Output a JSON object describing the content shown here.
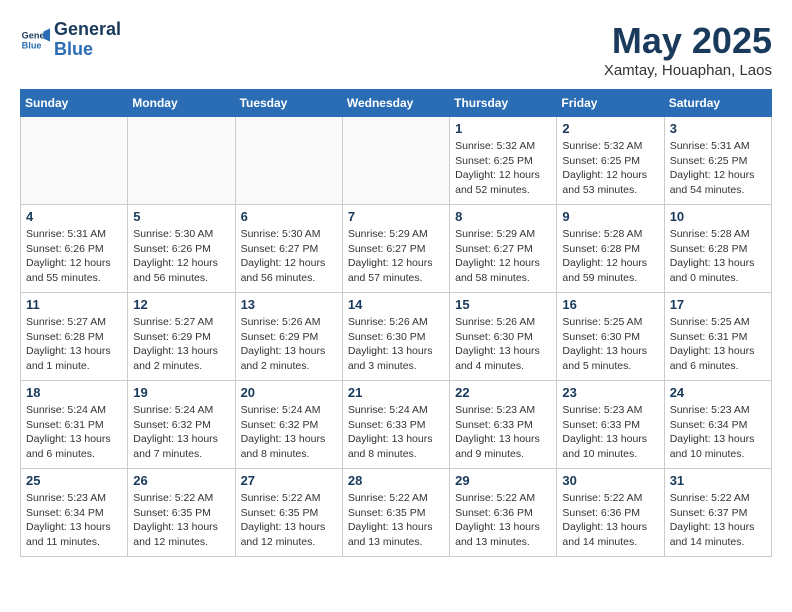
{
  "logo": {
    "line1": "General",
    "line2": "Blue"
  },
  "title": "May 2025",
  "subtitle": "Xamtay, Houaphan, Laos",
  "weekdays": [
    "Sunday",
    "Monday",
    "Tuesday",
    "Wednesday",
    "Thursday",
    "Friday",
    "Saturday"
  ],
  "weeks": [
    [
      {
        "day": "",
        "info": ""
      },
      {
        "day": "",
        "info": ""
      },
      {
        "day": "",
        "info": ""
      },
      {
        "day": "",
        "info": ""
      },
      {
        "day": "1",
        "info": "Sunrise: 5:32 AM\nSunset: 6:25 PM\nDaylight: 12 hours\nand 52 minutes."
      },
      {
        "day": "2",
        "info": "Sunrise: 5:32 AM\nSunset: 6:25 PM\nDaylight: 12 hours\nand 53 minutes."
      },
      {
        "day": "3",
        "info": "Sunrise: 5:31 AM\nSunset: 6:25 PM\nDaylight: 12 hours\nand 54 minutes."
      }
    ],
    [
      {
        "day": "4",
        "info": "Sunrise: 5:31 AM\nSunset: 6:26 PM\nDaylight: 12 hours\nand 55 minutes."
      },
      {
        "day": "5",
        "info": "Sunrise: 5:30 AM\nSunset: 6:26 PM\nDaylight: 12 hours\nand 56 minutes."
      },
      {
        "day": "6",
        "info": "Sunrise: 5:30 AM\nSunset: 6:27 PM\nDaylight: 12 hours\nand 56 minutes."
      },
      {
        "day": "7",
        "info": "Sunrise: 5:29 AM\nSunset: 6:27 PM\nDaylight: 12 hours\nand 57 minutes."
      },
      {
        "day": "8",
        "info": "Sunrise: 5:29 AM\nSunset: 6:27 PM\nDaylight: 12 hours\nand 58 minutes."
      },
      {
        "day": "9",
        "info": "Sunrise: 5:28 AM\nSunset: 6:28 PM\nDaylight: 12 hours\nand 59 minutes."
      },
      {
        "day": "10",
        "info": "Sunrise: 5:28 AM\nSunset: 6:28 PM\nDaylight: 13 hours\nand 0 minutes."
      }
    ],
    [
      {
        "day": "11",
        "info": "Sunrise: 5:27 AM\nSunset: 6:28 PM\nDaylight: 13 hours\nand 1 minute."
      },
      {
        "day": "12",
        "info": "Sunrise: 5:27 AM\nSunset: 6:29 PM\nDaylight: 13 hours\nand 2 minutes."
      },
      {
        "day": "13",
        "info": "Sunrise: 5:26 AM\nSunset: 6:29 PM\nDaylight: 13 hours\nand 2 minutes."
      },
      {
        "day": "14",
        "info": "Sunrise: 5:26 AM\nSunset: 6:30 PM\nDaylight: 13 hours\nand 3 minutes."
      },
      {
        "day": "15",
        "info": "Sunrise: 5:26 AM\nSunset: 6:30 PM\nDaylight: 13 hours\nand 4 minutes."
      },
      {
        "day": "16",
        "info": "Sunrise: 5:25 AM\nSunset: 6:30 PM\nDaylight: 13 hours\nand 5 minutes."
      },
      {
        "day": "17",
        "info": "Sunrise: 5:25 AM\nSunset: 6:31 PM\nDaylight: 13 hours\nand 6 minutes."
      }
    ],
    [
      {
        "day": "18",
        "info": "Sunrise: 5:24 AM\nSunset: 6:31 PM\nDaylight: 13 hours\nand 6 minutes."
      },
      {
        "day": "19",
        "info": "Sunrise: 5:24 AM\nSunset: 6:32 PM\nDaylight: 13 hours\nand 7 minutes."
      },
      {
        "day": "20",
        "info": "Sunrise: 5:24 AM\nSunset: 6:32 PM\nDaylight: 13 hours\nand 8 minutes."
      },
      {
        "day": "21",
        "info": "Sunrise: 5:24 AM\nSunset: 6:33 PM\nDaylight: 13 hours\nand 8 minutes."
      },
      {
        "day": "22",
        "info": "Sunrise: 5:23 AM\nSunset: 6:33 PM\nDaylight: 13 hours\nand 9 minutes."
      },
      {
        "day": "23",
        "info": "Sunrise: 5:23 AM\nSunset: 6:33 PM\nDaylight: 13 hours\nand 10 minutes."
      },
      {
        "day": "24",
        "info": "Sunrise: 5:23 AM\nSunset: 6:34 PM\nDaylight: 13 hours\nand 10 minutes."
      }
    ],
    [
      {
        "day": "25",
        "info": "Sunrise: 5:23 AM\nSunset: 6:34 PM\nDaylight: 13 hours\nand 11 minutes."
      },
      {
        "day": "26",
        "info": "Sunrise: 5:22 AM\nSunset: 6:35 PM\nDaylight: 13 hours\nand 12 minutes."
      },
      {
        "day": "27",
        "info": "Sunrise: 5:22 AM\nSunset: 6:35 PM\nDaylight: 13 hours\nand 12 minutes."
      },
      {
        "day": "28",
        "info": "Sunrise: 5:22 AM\nSunset: 6:35 PM\nDaylight: 13 hours\nand 13 minutes."
      },
      {
        "day": "29",
        "info": "Sunrise: 5:22 AM\nSunset: 6:36 PM\nDaylight: 13 hours\nand 13 minutes."
      },
      {
        "day": "30",
        "info": "Sunrise: 5:22 AM\nSunset: 6:36 PM\nDaylight: 13 hours\nand 14 minutes."
      },
      {
        "day": "31",
        "info": "Sunrise: 5:22 AM\nSunset: 6:37 PM\nDaylight: 13 hours\nand 14 minutes."
      }
    ]
  ]
}
